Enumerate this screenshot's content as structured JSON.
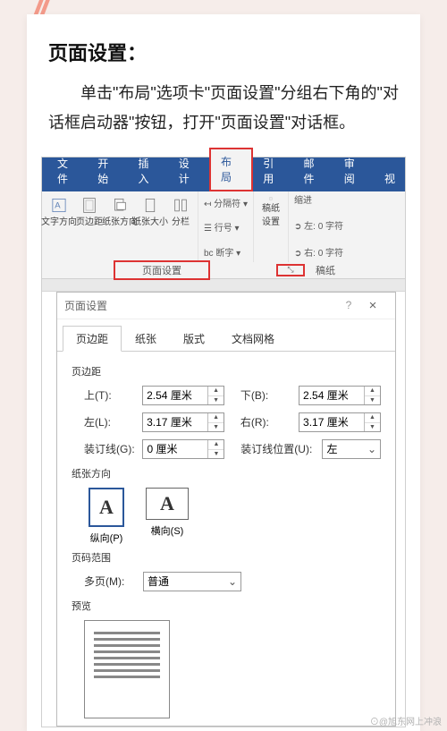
{
  "quote": "//",
  "heading": "页面设置：",
  "body": "单击\"布局\"选项卡\"页面设置\"分组右下角的\"对话框启动器\"按钮，打开\"页面设置\"对话框。",
  "ribbon": {
    "tabs": [
      "文件",
      "开始",
      "插入",
      "设计",
      "布局",
      "引用",
      "邮件",
      "审阅",
      "视"
    ],
    "active": "布局",
    "groups": {
      "text_dir": "文字方向",
      "margins": "页边距",
      "orient": "纸张方向",
      "size": "纸张大小",
      "cols": "分栏",
      "breaks": "分隔符",
      "linenum": "行号",
      "hyphen": "断字",
      "draft": "稿纸\n设置",
      "indent": "缩进",
      "left0": "左: 0 字符",
      "right0": "右: 0 字符",
      "pagesetup_label": "页面设置",
      "paper_label": "稿纸"
    }
  },
  "dialog": {
    "title": "页面设置",
    "tabs": [
      "页边距",
      "纸张",
      "版式",
      "文档网格"
    ],
    "active_tab": "页边距",
    "section_margin": "页边距",
    "top_label": "上(T):",
    "top_value": "2.54 厘米",
    "bottom_label": "下(B):",
    "bottom_value": "2.54 厘米",
    "left_label": "左(L):",
    "left_value": "3.17 厘米",
    "right_label": "右(R):",
    "right_value": "3.17 厘米",
    "gutter_label": "装订线(G):",
    "gutter_value": "0 厘米",
    "gutter_pos_label": "装订线位置(U):",
    "gutter_pos_value": "左",
    "section_orient": "纸张方向",
    "portrait": "纵向(P)",
    "landscape": "横向(S)",
    "section_range": "页码范围",
    "multi_label": "多页(M):",
    "multi_value": "普通",
    "section_preview": "预览"
  },
  "watermark": "⊙@旭东网上冲浪"
}
